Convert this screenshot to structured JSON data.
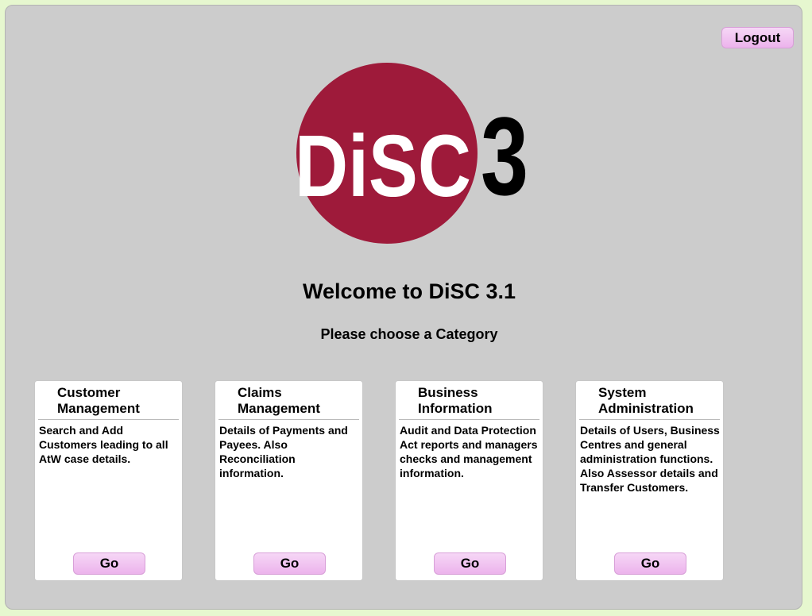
{
  "header": {
    "logout_label": "Logout"
  },
  "logo": {
    "text": "DiSC",
    "number": "3",
    "circle_color": "#9e1a3a",
    "text_color": "#ffffff",
    "number_color": "#000000"
  },
  "main": {
    "welcome": "Welcome to DiSC 3.1",
    "prompt": "Please choose a Category"
  },
  "categories": [
    {
      "title_line1": "Customer",
      "title_line2": "Management",
      "description": "Search and Add Customers leading to all AtW case details.",
      "go_label": "Go"
    },
    {
      "title_line1": "Claims",
      "title_line2": "Management",
      "description": "Details of Payments and Payees. Also Reconciliation information.",
      "go_label": "Go"
    },
    {
      "title_line1": "Business",
      "title_line2": "Information",
      "description": "Audit and Data Protection Act reports and managers checks and management information.",
      "go_label": "Go"
    },
    {
      "title_line1": "System",
      "title_line2": "Administration",
      "description": "Details of Users, Business Centres and general administration functions. Also Assessor details and Transfer Customers.",
      "go_label": "Go"
    }
  ],
  "colors": {
    "page_background": "#e6f7cf",
    "panel_background": "#cccccc",
    "button_pink": "#ecb3ec"
  }
}
